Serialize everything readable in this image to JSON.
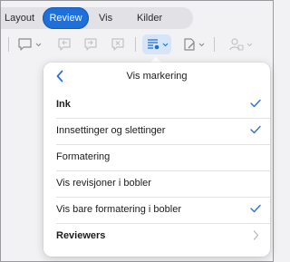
{
  "tabs": [
    {
      "label": "Layout"
    },
    {
      "label": "Review",
      "active": true
    },
    {
      "label": "Vis"
    },
    {
      "label": "Kilder"
    }
  ],
  "toolbar": {
    "icons": [
      "new-comment-icon",
      "previous-comment-icon",
      "next-comment-icon",
      "delete-comment-icon",
      "markup-display-icon",
      "track-changes-icon",
      "restrict-editing-icon"
    ]
  },
  "popover": {
    "title": "Vis markering",
    "items": [
      {
        "label": "Ink",
        "checked": true,
        "bold": true
      },
      {
        "label": "Innsettinger og slettinger",
        "checked": true
      },
      {
        "label": "Formatering",
        "checked": false
      },
      {
        "label": "Vis revisjoner i bobler",
        "checked": false
      },
      {
        "label": "Vis bare formatering i bobler",
        "checked": true
      },
      {
        "label": "Reviewers",
        "submenu": true,
        "bold": true
      }
    ]
  },
  "colors": {
    "accent": "#1e6fd9",
    "check": "#2f6fe0",
    "background": "#f2f2f4",
    "popover": "#ffffff"
  }
}
